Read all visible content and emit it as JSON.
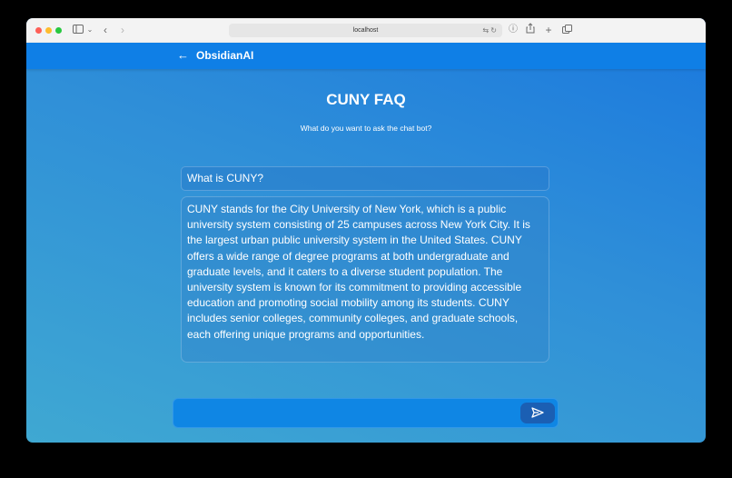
{
  "browser": {
    "url": "localhost"
  },
  "appbar": {
    "brand": "ObsidianAI"
  },
  "main": {
    "title": "CUNY FAQ",
    "subtitle": "What do you want to ask the chat bot?",
    "question": "What is CUNY?",
    "answer": "CUNY stands for the City University of New York, which is a public university system consisting of 25 campuses across New York City. It is the largest urban public university system in the United States. CUNY offers a wide range of degree programs at both undergraduate and graduate levels, and it caters to a diverse student population. The university system is known for its commitment to providing accessible education and promoting social mobility among its students. CUNY includes senior colleges, community colleges, and graduate schools, each offering unique programs and opportunities.",
    "input_value": ""
  },
  "colors": {
    "accent": "#0f7fe6",
    "send_button": "#1b5fb3"
  }
}
